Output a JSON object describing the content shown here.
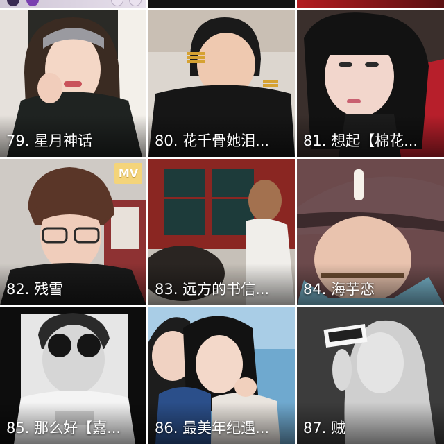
{
  "grid": {
    "items": [
      {
        "caption": "79. 星月神话"
      },
      {
        "caption": "80. 花千骨她泪..."
      },
      {
        "caption": "81. 想起【棉花..."
      },
      {
        "caption": "82. 残雪",
        "badge": "MV"
      },
      {
        "caption": "83. 远方的书信..."
      },
      {
        "caption": "84. 海芋恋"
      },
      {
        "caption": "85. 那么好【嘉..."
      },
      {
        "caption": "86. 最美年纪遇..."
      },
      {
        "caption": "87. 贼"
      }
    ]
  },
  "colors": {
    "caption_text": "#ffffff",
    "badge_background": "#f4d47a",
    "page_background": "#ffffff"
  }
}
